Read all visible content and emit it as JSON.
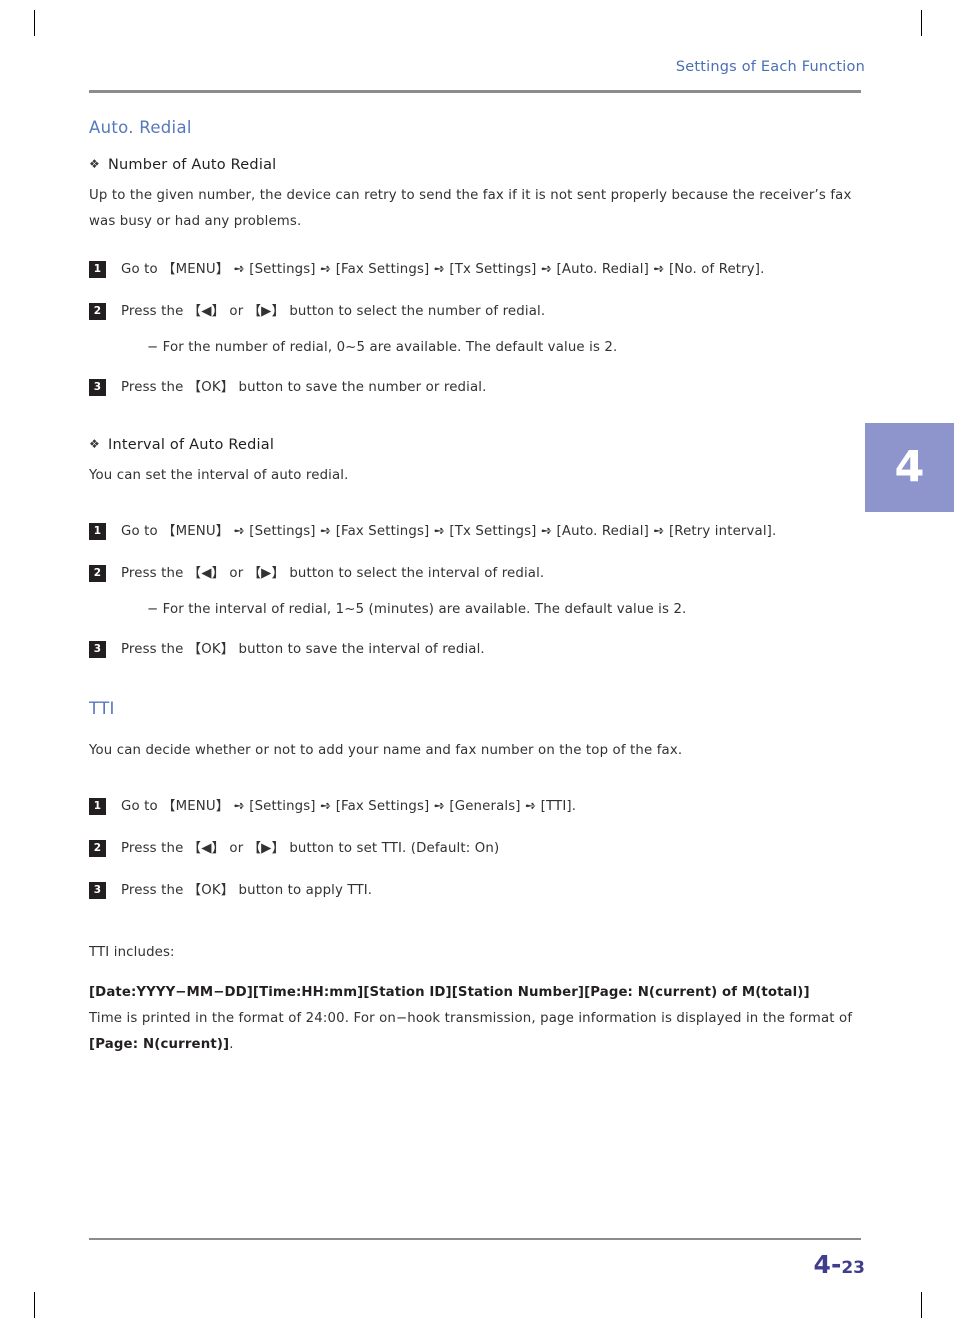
{
  "header": {
    "title": "Settings of Each Function"
  },
  "chapter_tab": "4",
  "sections": {
    "auto_redial": {
      "heading": "Auto. Redial",
      "sub1": {
        "title": "Number of Auto Redial",
        "body": "Up to the given number, the device can retry to send the fax if it is not sent properly because the receiver’s fax was busy or had any problems.",
        "step1_num": "1",
        "step1": "Go to 【MENU】 ➺ [Settings] ➺ [Fax Settings] ➺ [Tx Settings] ➺ [Auto. Redial] ➺ [No. of Retry].",
        "step2_num": "2",
        "step2": "Press the 【◀】 or 【▶】 button to select the number of redial.",
        "note": "− For the number of redial, 0~5 are available. The default value is 2.",
        "step3_num": "3",
        "step3": "Press the 【OK】 button to save the number or redial."
      },
      "sub2": {
        "title": "Interval of Auto Redial",
        "body": "You can set the interval of auto redial.",
        "step1_num": "1",
        "step1": "Go to 【MENU】 ➺ [Settings] ➺ [Fax Settings] ➺ [Tx Settings] ➺ [Auto. Redial] ➺ [Retry interval].",
        "step2_num": "2",
        "step2": "Press the 【◀】 or 【▶】 button to select the interval of redial.",
        "note": "− For the interval of redial, 1~5 (minutes) are available. The default value is 2.",
        "step3_num": "3",
        "step3": "Press the 【OK】 button to save the interval of redial."
      }
    },
    "tti": {
      "heading": "TTI",
      "body": "You can decide whether or not to add your name and fax number on the top of the fax.",
      "step1_num": "1",
      "step1": "Go to 【MENU】 ➺ [Settings] ➺ [Fax Settings] ➺ [Generals] ➺ [TTI].",
      "step2_num": "2",
      "step2": "Press the 【◀】 or 【▶】 button to set TTI. (Default: On)",
      "step3_num": "3",
      "step3": "Press the 【OK】 button to apply TTI.",
      "includes_label": "TTI includes:",
      "format_line": "[Date:YYYY−MM−DD][Time:HH:mm][Station ID][Station Number][Page: N(current) of M(total)]",
      "explain_prefix": "Time is printed in the format of 24:00. For on−hook transmission, page information is displayed in the format of ",
      "explain_bold": "[Page: N(current)]",
      "explain_suffix": "."
    }
  },
  "footer": {
    "chapter": "4-",
    "page": "23"
  },
  "colors": {
    "heading_blue": "#5578bd",
    "header_blue": "#4a6fb5",
    "tab_purple": "#8d95cc",
    "footer_navy": "#3e3e8c",
    "text": "#333132"
  }
}
